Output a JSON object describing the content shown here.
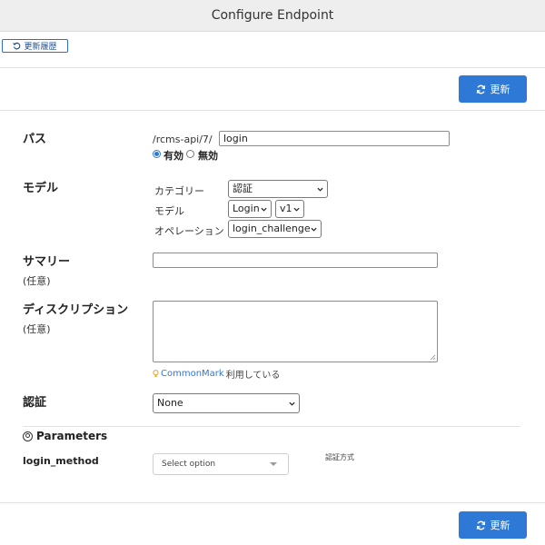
{
  "window": {
    "title": "Configure Endpoint"
  },
  "toolbar": {
    "history_label": "更新履歴",
    "update_label": "更新"
  },
  "form": {
    "path": {
      "label": "パス",
      "prefix": "/rcms-api/7/",
      "value": "login",
      "status_options": [
        {
          "label": "有効",
          "checked": true
        },
        {
          "label": "無効",
          "checked": false
        }
      ]
    },
    "model": {
      "label": "モデル",
      "category_label": "カテゴリー",
      "category_value": "認証",
      "model_label": "モデル",
      "model_value": "Login",
      "version_value": "v1",
      "operation_label": "オペレーション",
      "operation_value": "login_challenge"
    },
    "summary": {
      "label": "サマリー",
      "optional": "(任意)",
      "value": ""
    },
    "description": {
      "label": "ディスクリプション",
      "optional": "(任意)",
      "value": "",
      "hint_link": "CommonMark",
      "hint_text": "利用している"
    },
    "auth": {
      "label": "認証",
      "value": "None"
    }
  },
  "parameters": {
    "title": "Parameters",
    "items": [
      {
        "name": "login_method",
        "placeholder": "Select option",
        "description": "認証方式"
      }
    ]
  },
  "colors": {
    "primary": "#2f79d6",
    "titlebar_bg": "#eeeeee",
    "hint_icon": "#f0a030"
  }
}
